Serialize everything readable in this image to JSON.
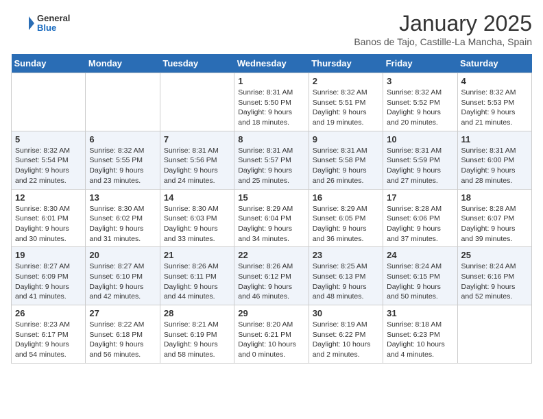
{
  "header": {
    "logo_line1": "General",
    "logo_line2": "Blue",
    "month_title": "January 2025",
    "subtitle": "Banos de Tajo, Castille-La Mancha, Spain"
  },
  "weekdays": [
    "Sunday",
    "Monday",
    "Tuesday",
    "Wednesday",
    "Thursday",
    "Friday",
    "Saturday"
  ],
  "weeks": [
    [
      {
        "day": "",
        "info": ""
      },
      {
        "day": "",
        "info": ""
      },
      {
        "day": "",
        "info": ""
      },
      {
        "day": "1",
        "info": "Sunrise: 8:31 AM\nSunset: 5:50 PM\nDaylight: 9 hours\nand 18 minutes."
      },
      {
        "day": "2",
        "info": "Sunrise: 8:32 AM\nSunset: 5:51 PM\nDaylight: 9 hours\nand 19 minutes."
      },
      {
        "day": "3",
        "info": "Sunrise: 8:32 AM\nSunset: 5:52 PM\nDaylight: 9 hours\nand 20 minutes."
      },
      {
        "day": "4",
        "info": "Sunrise: 8:32 AM\nSunset: 5:53 PM\nDaylight: 9 hours\nand 21 minutes."
      }
    ],
    [
      {
        "day": "5",
        "info": "Sunrise: 8:32 AM\nSunset: 5:54 PM\nDaylight: 9 hours\nand 22 minutes."
      },
      {
        "day": "6",
        "info": "Sunrise: 8:32 AM\nSunset: 5:55 PM\nDaylight: 9 hours\nand 23 minutes."
      },
      {
        "day": "7",
        "info": "Sunrise: 8:31 AM\nSunset: 5:56 PM\nDaylight: 9 hours\nand 24 minutes."
      },
      {
        "day": "8",
        "info": "Sunrise: 8:31 AM\nSunset: 5:57 PM\nDaylight: 9 hours\nand 25 minutes."
      },
      {
        "day": "9",
        "info": "Sunrise: 8:31 AM\nSunset: 5:58 PM\nDaylight: 9 hours\nand 26 minutes."
      },
      {
        "day": "10",
        "info": "Sunrise: 8:31 AM\nSunset: 5:59 PM\nDaylight: 9 hours\nand 27 minutes."
      },
      {
        "day": "11",
        "info": "Sunrise: 8:31 AM\nSunset: 6:00 PM\nDaylight: 9 hours\nand 28 minutes."
      }
    ],
    [
      {
        "day": "12",
        "info": "Sunrise: 8:30 AM\nSunset: 6:01 PM\nDaylight: 9 hours\nand 30 minutes."
      },
      {
        "day": "13",
        "info": "Sunrise: 8:30 AM\nSunset: 6:02 PM\nDaylight: 9 hours\nand 31 minutes."
      },
      {
        "day": "14",
        "info": "Sunrise: 8:30 AM\nSunset: 6:03 PM\nDaylight: 9 hours\nand 33 minutes."
      },
      {
        "day": "15",
        "info": "Sunrise: 8:29 AM\nSunset: 6:04 PM\nDaylight: 9 hours\nand 34 minutes."
      },
      {
        "day": "16",
        "info": "Sunrise: 8:29 AM\nSunset: 6:05 PM\nDaylight: 9 hours\nand 36 minutes."
      },
      {
        "day": "17",
        "info": "Sunrise: 8:28 AM\nSunset: 6:06 PM\nDaylight: 9 hours\nand 37 minutes."
      },
      {
        "day": "18",
        "info": "Sunrise: 8:28 AM\nSunset: 6:07 PM\nDaylight: 9 hours\nand 39 minutes."
      }
    ],
    [
      {
        "day": "19",
        "info": "Sunrise: 8:27 AM\nSunset: 6:09 PM\nDaylight: 9 hours\nand 41 minutes."
      },
      {
        "day": "20",
        "info": "Sunrise: 8:27 AM\nSunset: 6:10 PM\nDaylight: 9 hours\nand 42 minutes."
      },
      {
        "day": "21",
        "info": "Sunrise: 8:26 AM\nSunset: 6:11 PM\nDaylight: 9 hours\nand 44 minutes."
      },
      {
        "day": "22",
        "info": "Sunrise: 8:26 AM\nSunset: 6:12 PM\nDaylight: 9 hours\nand 46 minutes."
      },
      {
        "day": "23",
        "info": "Sunrise: 8:25 AM\nSunset: 6:13 PM\nDaylight: 9 hours\nand 48 minutes."
      },
      {
        "day": "24",
        "info": "Sunrise: 8:24 AM\nSunset: 6:15 PM\nDaylight: 9 hours\nand 50 minutes."
      },
      {
        "day": "25",
        "info": "Sunrise: 8:24 AM\nSunset: 6:16 PM\nDaylight: 9 hours\nand 52 minutes."
      }
    ],
    [
      {
        "day": "26",
        "info": "Sunrise: 8:23 AM\nSunset: 6:17 PM\nDaylight: 9 hours\nand 54 minutes."
      },
      {
        "day": "27",
        "info": "Sunrise: 8:22 AM\nSunset: 6:18 PM\nDaylight: 9 hours\nand 56 minutes."
      },
      {
        "day": "28",
        "info": "Sunrise: 8:21 AM\nSunset: 6:19 PM\nDaylight: 9 hours\nand 58 minutes."
      },
      {
        "day": "29",
        "info": "Sunrise: 8:20 AM\nSunset: 6:21 PM\nDaylight: 10 hours\nand 0 minutes."
      },
      {
        "day": "30",
        "info": "Sunrise: 8:19 AM\nSunset: 6:22 PM\nDaylight: 10 hours\nand 2 minutes."
      },
      {
        "day": "31",
        "info": "Sunrise: 8:18 AM\nSunset: 6:23 PM\nDaylight: 10 hours\nand 4 minutes."
      },
      {
        "day": "",
        "info": ""
      }
    ]
  ]
}
